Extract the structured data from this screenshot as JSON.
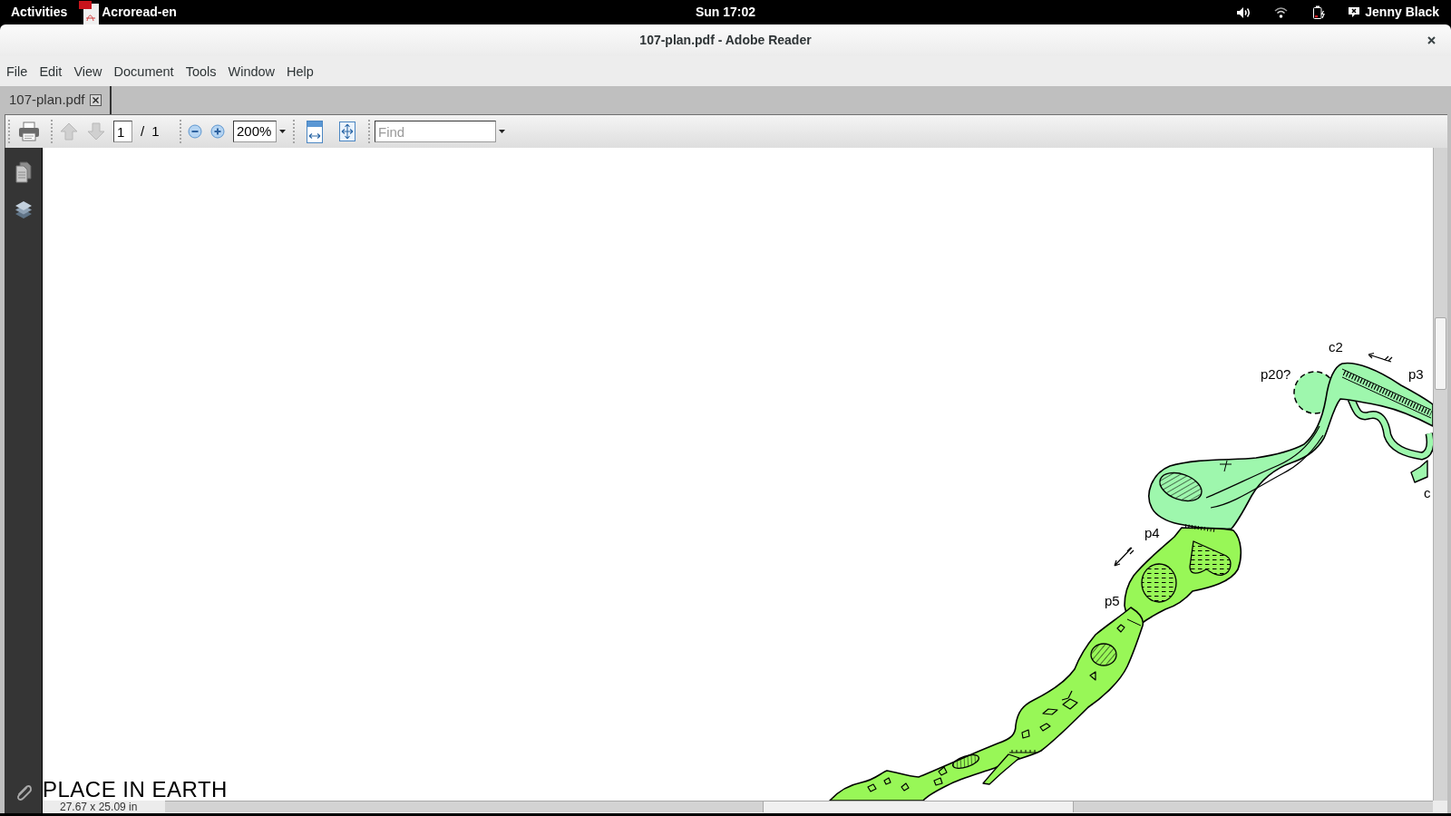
{
  "top_bar": {
    "activities": "Activities",
    "app_name": "Acroread-en",
    "clock": "Sun 17:02",
    "user_name": "Jenny Black"
  },
  "window": {
    "title": "107-plan.pdf - Adobe Reader"
  },
  "menu_bar": [
    "File",
    "Edit",
    "View",
    "Document",
    "Tools",
    "Window",
    "Help"
  ],
  "tabs": [
    {
      "label": "107-plan.pdf",
      "selected": true
    }
  ],
  "toolbar": {
    "previous_page": {
      "disabled": true
    },
    "next_page": {
      "disabled": true
    },
    "page_number": "1",
    "page_count": "/ 1",
    "zoom": "200%",
    "find": {
      "placeholder": "Find"
    }
  },
  "document": {
    "map_labels": [
      "c2",
      "p20?",
      "p3",
      "c",
      "p4",
      "p5"
    ],
    "heading": "PLACE IN EARTH"
  },
  "status_bar": {
    "page_size": "27.67 x 25.09 in"
  }
}
